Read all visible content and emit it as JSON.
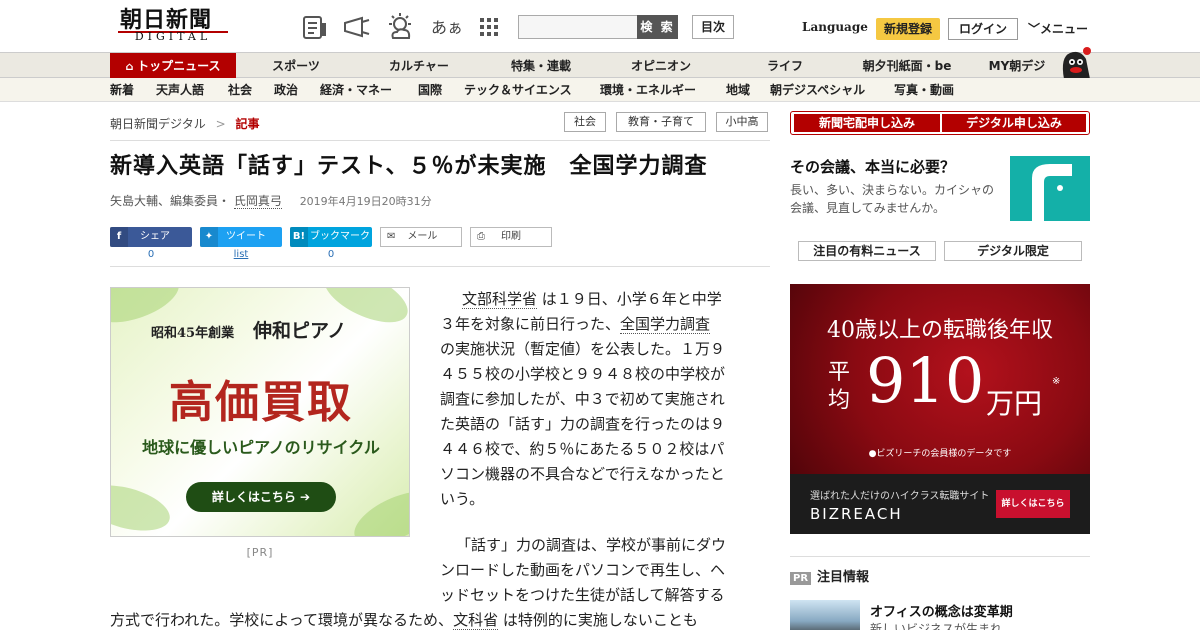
{
  "header": {
    "logo_main": "朝日新聞",
    "logo_sub": "DIGITAL",
    "icons": [
      "paper-icon",
      "megaphone-icon",
      "weather-icon",
      "font-size-icon",
      "apps-grid-icon"
    ],
    "font_icon_text": "あぁ",
    "search_placeholder": "",
    "search_button": "検 索",
    "toc_button": "目次",
    "language": "Language",
    "signup": "新規登録",
    "login": "ログイン",
    "menu": "メニュー"
  },
  "main_nav": [
    "トップニュース",
    "スポーツ",
    "カルチャー",
    "特集・連載",
    "オピニオン",
    "ライフ",
    "朝夕刊紙面・be",
    "MY朝デジ"
  ],
  "sub_nav": [
    "新着",
    "天声人語",
    "社会",
    "政治",
    "経済・マネー",
    "国際",
    "テック＆サイエンス",
    "環境・エネルギー",
    "地域",
    "朝デジスペシャル",
    "写真・動画"
  ],
  "breadcrumb": {
    "home": "朝日新聞デジタル",
    "sep": ">",
    "current": "記事"
  },
  "tags": [
    "社会",
    "教育・子育て",
    "小中高"
  ],
  "article": {
    "title": "新導入英語「話す」テスト、５％が未実施　全国学力調査",
    "author1": "矢島大輔、編集委員・",
    "author2": "氏岡真弓",
    "date": "2019年4月19日20時31分",
    "share": {
      "facebook_label": "シェア",
      "facebook_count": "0",
      "twitter_label": "ツイート",
      "twitter_count": "list",
      "hatena_label": "ブックマーク",
      "hatena_count": "0",
      "mail_label": "メール",
      "print_label": "印刷"
    },
    "p1_link1": "文部科学省",
    "p1_a": " は１９日、小学６年と中学",
    "p1_b": "３年を対象に前日行った、",
    "p1_link2": "全国学力調査",
    "p1_rest": [
      "の実施状況（暫定値）を公表した。１万９",
      "４５５校の小学校と９９４８校の中学校が",
      "調査に参加したが、中３で初めて実施され",
      "た英語の「話す」力の調査を行ったのは９",
      "４４６校で、約５％にあたる５０２校はパ",
      "ソコン機器の不具合などで行えなかったと",
      "いう。"
    ],
    "p2": [
      "「話す」力の調査は、学校が事前にダウ",
      "ンロードした動画をパソコンで再生し、ヘ",
      "ッドセットをつけた生徒が話して解答する"
    ],
    "p2_last": "方式で行われた。学校によって環境が異なるため、",
    "p2_link": "文科省",
    "p2_tail": " は特例的に実施しないことも"
  },
  "ad_left": {
    "sub": "昭和45年創業",
    "brand": "伸和ピアノ",
    "main": "高価買取",
    "line": "地球に優しいピアノのリサイクル",
    "button": "詳しくはこちら ➔",
    "pr": "[PR]"
  },
  "right": {
    "btn1": "新聞宅配申し込み",
    "btn2": "デジタル申し込み",
    "promo_title": "その会議、本当に必要？",
    "promo_text": "長い、多い、決まらない。カイシャの会議、見直してみませんか。",
    "tab1": "注目の有料ニュース",
    "tab2": "デジタル限定",
    "biz": {
      "head": "40歳以上の転職後年収",
      "avg": "平均",
      "num": "910",
      "unit": "万円",
      "ast": "※",
      "note": "●ビズリーチの会員様のデータです",
      "small": "選ばれた人だけのハイクラス転職サイト",
      "logo": "BIZREACH",
      "cta": "詳しくはこちら"
    },
    "attention_badge": "PR",
    "attention": "注目情報",
    "news_title": "オフィスの概念は変革期",
    "news_sub": "新しいビジネスが生まれ"
  },
  "colors": {
    "brand_red": "#b30000",
    "signup_yellow": "#f5c842",
    "facebook": "#3b5998",
    "twitter": "#1da1f2",
    "hatena": "#00a4de",
    "promo_teal": "#14b0a8"
  }
}
